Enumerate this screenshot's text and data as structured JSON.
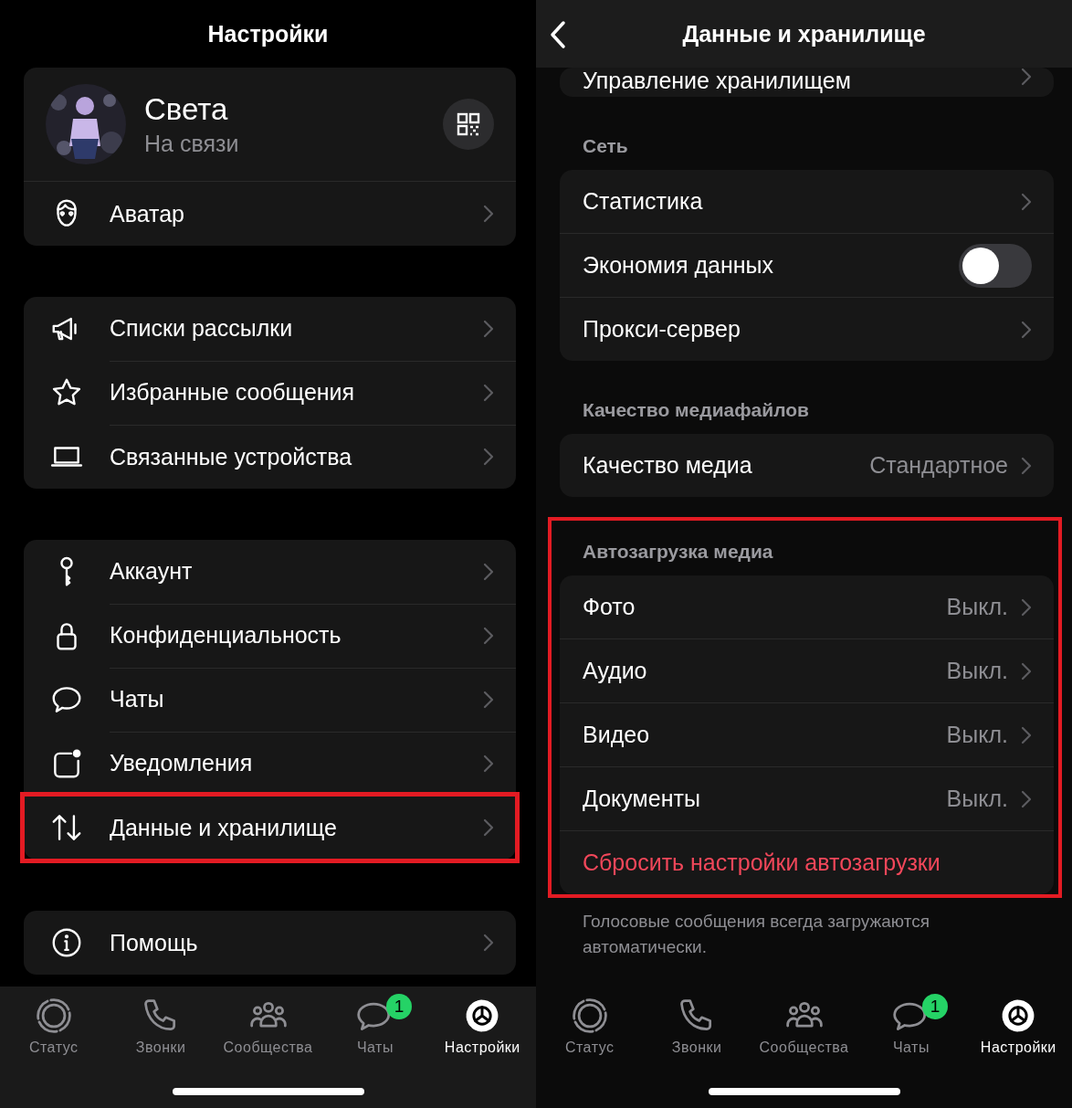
{
  "settings_screen": {
    "title": "Настройки",
    "profile": {
      "name": "Света",
      "status": "На связи"
    },
    "groups": [
      {
        "items": [
          {
            "label": "Аватар",
            "highlighted": false
          }
        ]
      },
      {
        "items": [
          {
            "label": "Списки рассылки",
            "highlighted": false
          },
          {
            "label": "Избранные сообщения",
            "highlighted": false
          },
          {
            "label": "Связанные устройства",
            "highlighted": false
          }
        ]
      },
      {
        "items": [
          {
            "label": "Аккаунт",
            "highlighted": false
          },
          {
            "label": "Конфиденциальность",
            "highlighted": false
          },
          {
            "label": "Чаты",
            "highlighted": false
          },
          {
            "label": "Уведомления",
            "highlighted": false
          },
          {
            "label": "Данные и хранилище",
            "highlighted": true
          }
        ]
      },
      {
        "items": [
          {
            "label": "Помощь",
            "highlighted": false
          }
        ]
      }
    ],
    "tab_bar": [
      {
        "label": "Статус",
        "selected": false
      },
      {
        "label": "Звонки",
        "selected": false
      },
      {
        "label": "Сообщества",
        "selected": false
      },
      {
        "label": "Чаты",
        "selected": false,
        "badge": "1"
      },
      {
        "label": "Настройки",
        "selected": true
      }
    ]
  },
  "data_screen": {
    "title": "Данные и хранилище",
    "sections": [
      {
        "highlighted": false,
        "rows": [
          {
            "kind": "link",
            "label": "Управление хранилищем"
          }
        ]
      },
      {
        "header": "Сеть",
        "highlighted": false,
        "rows": [
          {
            "kind": "link",
            "label": "Статистика"
          },
          {
            "kind": "toggle",
            "label": "Экономия данных",
            "on": false
          },
          {
            "kind": "link",
            "label": "Прокси-сервер"
          }
        ]
      },
      {
        "header": "Качество медиафайлов",
        "highlighted": false,
        "rows": [
          {
            "kind": "link",
            "label": "Качество медиа",
            "value": "Стандартное"
          }
        ]
      },
      {
        "header": "Автозагрузка медиа",
        "highlighted": true,
        "rows": [
          {
            "kind": "link",
            "label": "Фото",
            "value": "Выкл."
          },
          {
            "kind": "link",
            "label": "Аудио",
            "value": "Выкл."
          },
          {
            "kind": "link",
            "label": "Видео",
            "value": "Выкл."
          },
          {
            "kind": "link",
            "label": "Документы",
            "value": "Выкл."
          },
          {
            "kind": "action",
            "label": "Сбросить настройки автозагрузки"
          }
        ]
      }
    ],
    "footnote": "Голосовые сообщения всегда загружаются автоматически.",
    "tab_bar": [
      {
        "label": "Статус",
        "selected": false
      },
      {
        "label": "Звонки",
        "selected": false
      },
      {
        "label": "Сообщества",
        "selected": false
      },
      {
        "label": "Чаты",
        "selected": false,
        "badge": "1"
      },
      {
        "label": "Настройки",
        "selected": true
      }
    ]
  }
}
